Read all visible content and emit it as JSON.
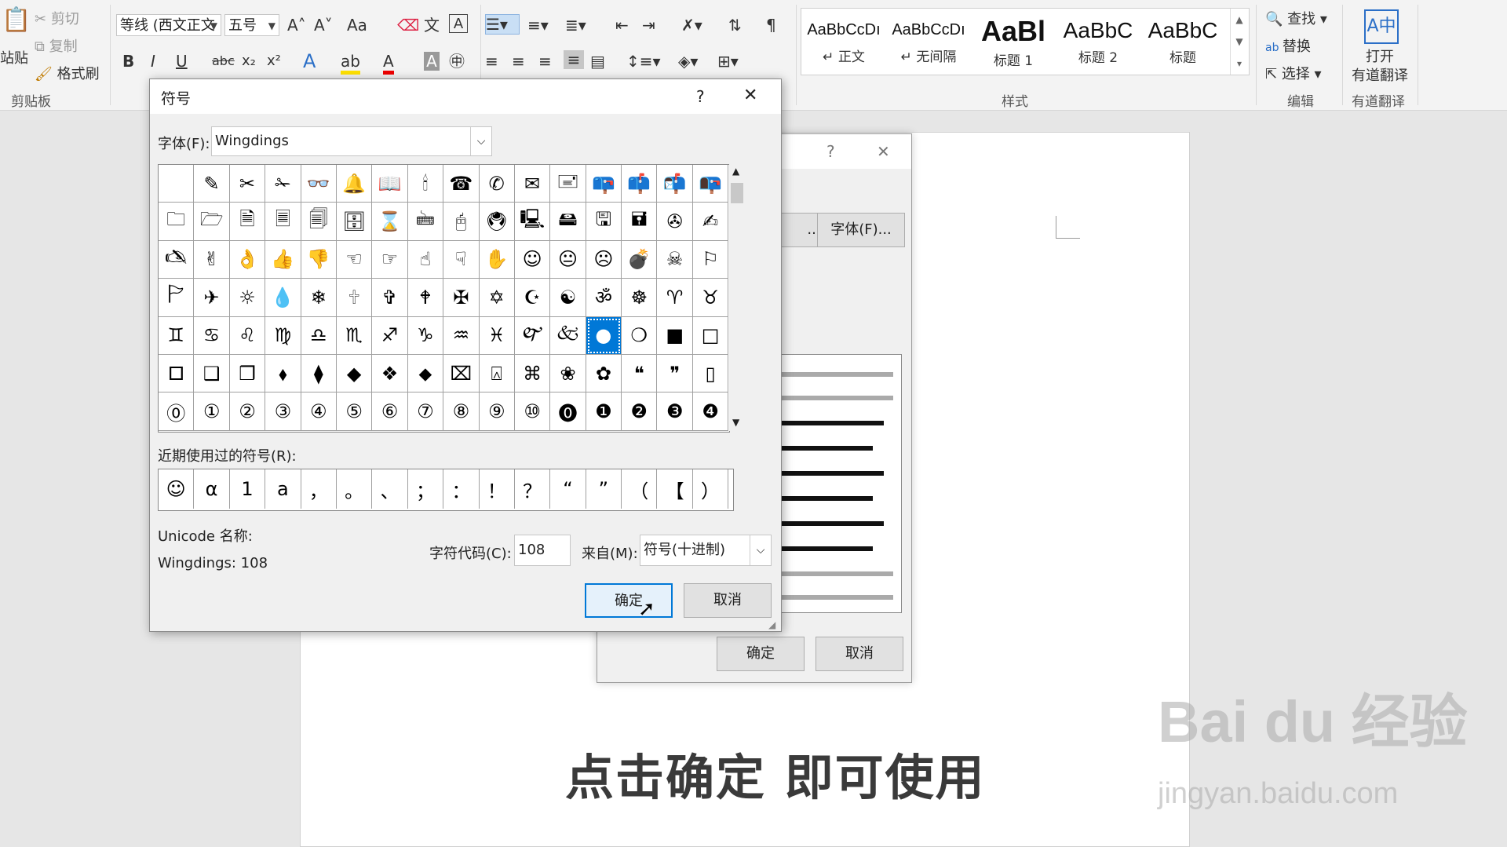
{
  "ribbon": {
    "clipboard": {
      "paste_partial": "站贴",
      "cut": "剪切",
      "copy": "复制",
      "format_painter": "格式刷",
      "group_label": "剪贴板"
    },
    "font": {
      "family": "等线 (西文正文",
      "size": "五号",
      "bold": "B",
      "italic": "I",
      "underline": "U",
      "strike": "abc",
      "sub": "x₂",
      "sup": "x²",
      "grow": "A˄",
      "shrink": "A˅",
      "case": "Aa"
    },
    "styles": {
      "items": [
        {
          "preview": "AaBbCcDı",
          "name": "↵ 正文"
        },
        {
          "preview": "AaBbCcDı",
          "name": "↵ 无间隔"
        },
        {
          "preview": "AaBl",
          "name": "标题 1"
        },
        {
          "preview": "AaBbC",
          "name": "标题 2"
        },
        {
          "preview": "AaBbC",
          "name": "标题"
        }
      ],
      "group_label": "样式"
    },
    "editing": {
      "find": "查找",
      "replace": "替换",
      "select": "选择",
      "group_label": "编辑"
    },
    "youdao": {
      "open_line1": "打开",
      "open_line2": "有道翻译",
      "group_label": "有道翻译"
    }
  },
  "underlying_dialog": {
    "help": "?",
    "close": "✕",
    "partial_button": "...",
    "font_button": "字体(F)...",
    "ok": "确定",
    "cancel": "取消"
  },
  "symbol_dialog": {
    "title": "符号",
    "help": "?",
    "close": "✕",
    "font_label": "字体(F):",
    "font_value": "Wingdings",
    "recent_label": "近期使用过的符号(R):",
    "unicode_name_label": "Unicode 名称:",
    "unicode_name_value": "Wingdings: 108",
    "char_code_label": "字符代码(C):",
    "char_code_value": "108",
    "from_label": "来自(M):",
    "from_value": "符号(十进制)",
    "ok": "确定",
    "cancel": "取消",
    "symbols": [
      [
        " ",
        "✎",
        "✂",
        "✁",
        "👓",
        "🔔",
        "📖",
        "🕯",
        "☎",
        "✆",
        "✉",
        "🖃",
        "📪",
        "📫",
        "📬",
        "📭"
      ],
      [
        "🗀",
        "🗁",
        "🗎",
        "🗏",
        "🗐",
        "🗄",
        "⌛",
        "🖮",
        "🖰",
        "🖲",
        "🖳",
        "🖴",
        "🖫",
        "🖬",
        "✇",
        "✍"
      ],
      [
        "🖎",
        "✌",
        "👌",
        "👍",
        "👎",
        "☜",
        "☞",
        "☝",
        "☟",
        "✋",
        "☺",
        "😐",
        "☹",
        "💣",
        "☠",
        "⚐"
      ],
      [
        "🏱",
        "✈",
        "☼",
        "💧",
        "❄",
        "🕆",
        "✞",
        "🕈",
        "✠",
        "✡",
        "☪",
        "☯",
        "ॐ",
        "☸",
        "♈",
        "♉"
      ],
      [
        "♊",
        "♋",
        "♌",
        "♍",
        "♎",
        "♏",
        "♐",
        "♑",
        "♒",
        "♓",
        "🙰",
        "🙵",
        "●",
        "❍",
        "■",
        "□"
      ],
      [
        "🞐",
        "❑",
        "❒",
        "⬧",
        "⧫",
        "◆",
        "❖",
        "⬥",
        "⌧",
        "⍓",
        "⌘",
        "❀",
        "✿",
        "❝",
        "❞",
        "▯"
      ],
      [
        "⓪",
        "①",
        "②",
        "③",
        "④",
        "⑤",
        "⑥",
        "⑦",
        "⑧",
        "⑨",
        "⑩",
        "⓿",
        "❶",
        "❷",
        "❸",
        "❹"
      ]
    ],
    "selected_symbol": "●",
    "recent": [
      "☺",
      "α",
      "1",
      "a",
      "，",
      "。",
      "、",
      "；",
      "：",
      "！",
      "？",
      "“",
      "”",
      "（",
      "【",
      "）"
    ]
  },
  "caption": "点击确定 即可使用",
  "watermark": {
    "logo": "Bai du 经验",
    "url": "jingyan.baidu.com"
  }
}
